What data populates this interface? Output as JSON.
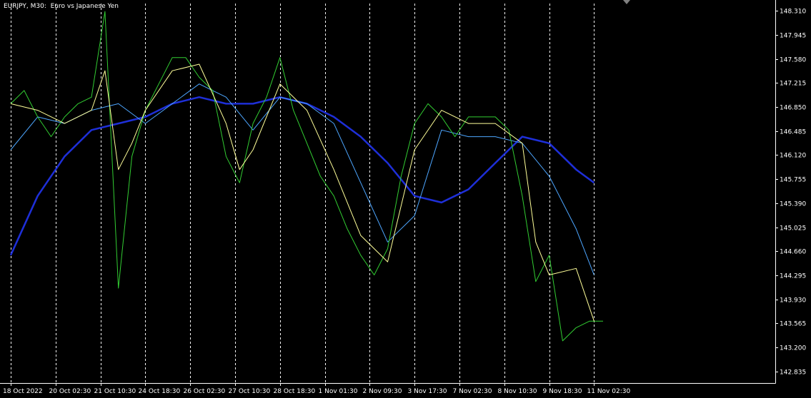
{
  "chart_title": "EURJPY, M30:  Euro vs Japanese Yen",
  "colors": {
    "background": "#000000",
    "foreground": "#ffffff",
    "grid": "#ffffff",
    "price": "#32cd32",
    "ma_fast": "#ffff99",
    "ma_mid": "#4da6ff",
    "ma_slow": "#1e2fd8",
    "marker": "#808080"
  },
  "chart_data": {
    "type": "line",
    "title": "EURJPY, M30:  Euro vs Japanese Yen",
    "xlabel": "",
    "ylabel": "",
    "ylim": [
      142.66,
      148.42
    ],
    "grid": "vertical-dashed",
    "y_ticks": [
      "148.310",
      "147.945",
      "147.580",
      "147.215",
      "146.850",
      "146.485",
      "146.120",
      "145.755",
      "145.390",
      "145.025",
      "144.660",
      "144.295",
      "143.930",
      "143.565",
      "143.200",
      "142.835"
    ],
    "x_ticks": [
      "18 Oct 2022",
      "20 Oct 02:30",
      "21 Oct 10:30",
      "24 Oct 18:30",
      "26 Oct 02:30",
      "27 Oct 10:30",
      "28 Oct 18:30",
      "1 Nov 01:30",
      "2 Nov 09:30",
      "3 Nov 17:30",
      "7 Nov 02:30",
      "8 Nov 10:30",
      "9 Nov 18:30",
      "11 Nov 02:30"
    ],
    "series": [
      {
        "id": "price",
        "x": [
          0,
          0.3,
          0.6,
          0.9,
          1.2,
          1.5,
          1.8,
          2.1,
          2.4,
          2.7,
          3.0,
          3.3,
          3.6,
          3.9,
          4.2,
          4.5,
          4.8,
          5.1,
          5.4,
          5.7,
          6.0,
          6.3,
          6.6,
          6.9,
          7.2,
          7.5,
          7.8,
          8.1,
          8.4,
          8.7,
          9.0,
          9.3,
          9.6,
          9.9,
          10.2,
          10.5,
          10.8,
          11.1,
          11.4,
          11.7,
          12.0,
          12.3,
          12.6,
          12.9,
          13.0,
          13.2
        ],
        "values": [
          146.9,
          147.1,
          146.7,
          146.4,
          146.7,
          146.9,
          147.0,
          148.3,
          144.1,
          146.1,
          146.8,
          147.2,
          147.6,
          147.6,
          147.3,
          147.1,
          146.1,
          145.7,
          146.6,
          147.0,
          147.6,
          146.8,
          146.3,
          145.8,
          145.5,
          145.0,
          144.6,
          144.3,
          144.7,
          145.8,
          146.6,
          146.9,
          146.7,
          146.4,
          146.7,
          146.7,
          146.7,
          146.5,
          145.5,
          144.2,
          144.6,
          143.3,
          143.5,
          143.6,
          143.6,
          143.6
        ]
      },
      {
        "id": "ma_fast",
        "x": [
          0,
          0.6,
          1.2,
          1.8,
          2.1,
          2.4,
          2.7,
          3.0,
          3.6,
          4.2,
          4.8,
          5.1,
          5.4,
          6.0,
          6.6,
          7.2,
          7.8,
          8.4,
          9.0,
          9.6,
          10.2,
          10.8,
          11.4,
          11.7,
          12.0,
          12.6,
          13.0
        ],
        "values": [
          146.9,
          146.8,
          146.6,
          146.8,
          147.4,
          145.9,
          146.3,
          146.8,
          147.4,
          147.5,
          146.6,
          145.9,
          146.2,
          147.2,
          146.8,
          145.9,
          144.9,
          144.5,
          146.2,
          146.8,
          146.6,
          146.6,
          146.3,
          144.8,
          144.3,
          144.4,
          143.6
        ]
      },
      {
        "id": "ma_mid",
        "x": [
          0,
          0.6,
          1.2,
          1.8,
          2.4,
          3.0,
          3.6,
          4.2,
          4.8,
          5.4,
          6.0,
          6.6,
          7.2,
          7.8,
          8.4,
          9.0,
          9.6,
          10.2,
          10.8,
          11.4,
          12.0,
          12.6,
          13.0
        ],
        "values": [
          146.2,
          146.7,
          146.6,
          146.8,
          146.9,
          146.6,
          146.9,
          147.2,
          147.0,
          146.5,
          147.0,
          146.9,
          146.6,
          145.7,
          144.8,
          145.2,
          146.5,
          146.4,
          146.4,
          146.3,
          145.8,
          145.0,
          144.3
        ]
      },
      {
        "id": "ma_slow",
        "x": [
          0,
          0.6,
          1.2,
          1.8,
          2.4,
          3.0,
          3.6,
          4.2,
          4.8,
          5.4,
          6.0,
          6.6,
          7.2,
          7.8,
          8.4,
          9.0,
          9.6,
          10.2,
          10.8,
          11.4,
          12.0,
          12.6,
          13.0
        ],
        "values": [
          144.6,
          145.5,
          146.1,
          146.5,
          146.6,
          146.7,
          146.9,
          147.0,
          146.9,
          146.9,
          147.0,
          146.9,
          146.7,
          146.4,
          146.0,
          145.5,
          145.4,
          145.6,
          146.0,
          146.4,
          146.3,
          145.9,
          145.7
        ]
      }
    ]
  }
}
